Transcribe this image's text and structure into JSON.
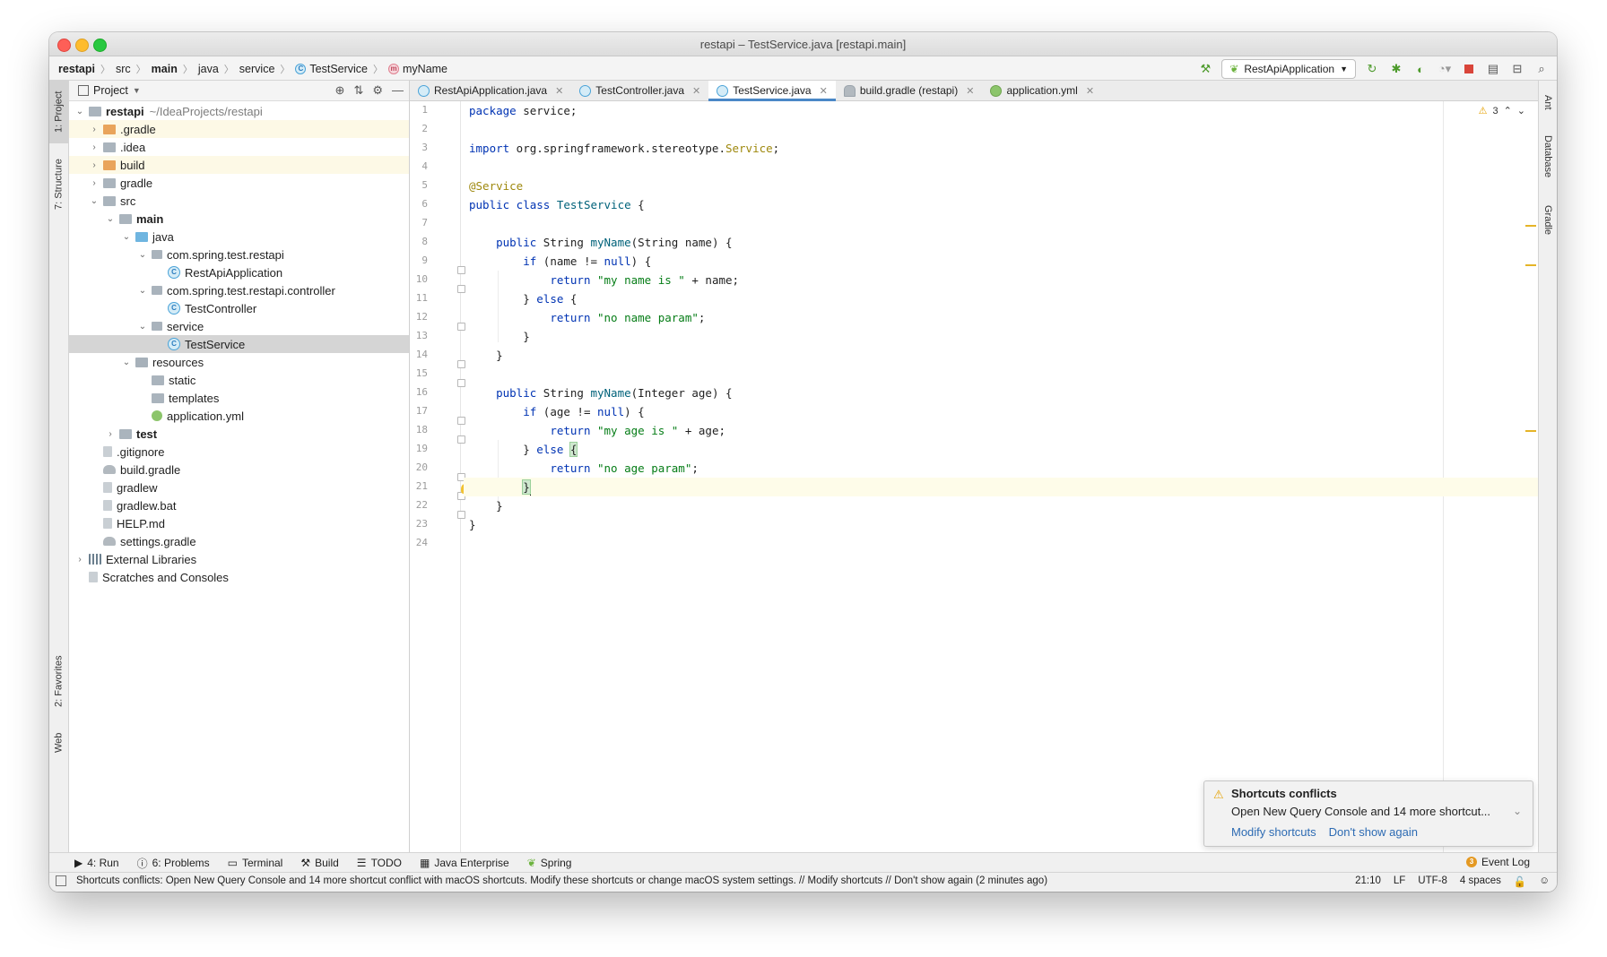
{
  "window": {
    "title": "restapi – TestService.java [restapi.main]"
  },
  "breadcrumbs": [
    "restapi",
    "src",
    "main",
    "java",
    "service",
    "TestService",
    "myName"
  ],
  "toolbar": {
    "run_config": "RestApiApplication"
  },
  "left_tabs": [
    "1: Project",
    "7: Structure",
    "2: Favorites",
    "Web"
  ],
  "right_tabs": [
    "Ant",
    "Database",
    "Gradle"
  ],
  "project_panel": {
    "title": "Project",
    "tree": [
      {
        "label": "restapi",
        "extra": "~/IdeaProjects/restapi"
      },
      {
        "label": ".gradle"
      },
      {
        "label": ".idea"
      },
      {
        "label": "build"
      },
      {
        "label": "gradle"
      },
      {
        "label": "src"
      },
      {
        "label": "main"
      },
      {
        "label": "java"
      },
      {
        "label": "com.spring.test.restapi"
      },
      {
        "label": "RestApiApplication"
      },
      {
        "label": "com.spring.test.restapi.controller"
      },
      {
        "label": "TestController"
      },
      {
        "label": "service"
      },
      {
        "label": "TestService"
      },
      {
        "label": "resources"
      },
      {
        "label": "static"
      },
      {
        "label": "templates"
      },
      {
        "label": "application.yml"
      },
      {
        "label": "test"
      },
      {
        "label": ".gitignore"
      },
      {
        "label": "build.gradle"
      },
      {
        "label": "gradlew"
      },
      {
        "label": "gradlew.bat"
      },
      {
        "label": "HELP.md"
      },
      {
        "label": "settings.gradle"
      },
      {
        "label": "External Libraries"
      },
      {
        "label": "Scratches and Consoles"
      }
    ]
  },
  "editor_tabs": [
    {
      "label": "RestApiApplication.java"
    },
    {
      "label": "TestController.java"
    },
    {
      "label": "TestService.java"
    },
    {
      "label": "build.gradle (restapi)"
    },
    {
      "label": "application.yml"
    }
  ],
  "editor": {
    "warnings_count": "3",
    "line_numbers": [
      "1",
      "2",
      "3",
      "4",
      "5",
      "6",
      "7",
      "8",
      "9",
      "10",
      "11",
      "12",
      "13",
      "14",
      "15",
      "16",
      "17",
      "18",
      "19",
      "20",
      "21",
      "22",
      "23",
      "24"
    ]
  },
  "bottom_tools": [
    "4: Run",
    "6: Problems",
    "Terminal",
    "Build",
    "TODO",
    "Java Enterprise",
    "Spring"
  ],
  "event_log": {
    "label": "Event Log",
    "count": "3"
  },
  "status": {
    "message": "Shortcuts conflicts: Open New Query Console and 14 more shortcut conflict with macOS shortcuts. Modify these shortcuts or change macOS system settings. // Modify shortcuts // Don't show again (2 minutes ago)",
    "position": "21:10",
    "line_sep": "LF",
    "encoding": "UTF-8",
    "indent": "4 spaces"
  },
  "notification": {
    "title": "Shortcuts conflicts",
    "body": "Open New Query Console and 14 more shortcut...",
    "link_modify": "Modify shortcuts",
    "link_dismiss": "Don't show again"
  }
}
